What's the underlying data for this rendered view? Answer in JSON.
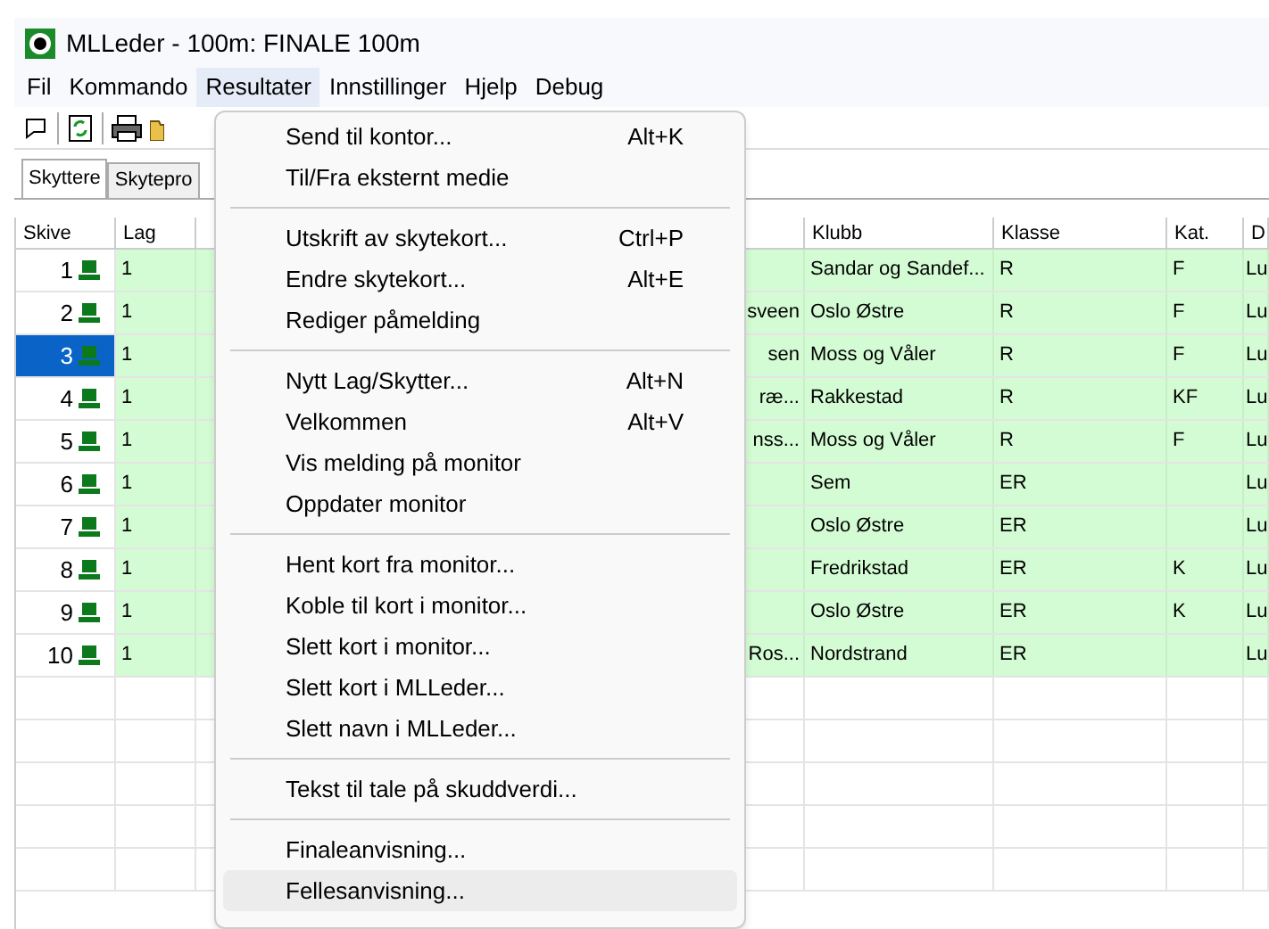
{
  "window": {
    "title": "MLLeder - 100m: FINALE 100m"
  },
  "menubar": [
    {
      "label": "Fil",
      "selected": false
    },
    {
      "label": "Kommando",
      "selected": false
    },
    {
      "label": "Resultater",
      "selected": true
    },
    {
      "label": "Innstillinger",
      "selected": false
    },
    {
      "label": "Hjelp",
      "selected": false
    },
    {
      "label": "Debug",
      "selected": false
    }
  ],
  "tabs": [
    {
      "label": "Skyttere",
      "selected": true
    },
    {
      "label": "Skytepro",
      "selected": false
    }
  ],
  "table": {
    "columns": [
      "Skive",
      "Lag",
      "",
      "",
      "Klubb",
      "Klasse",
      "Kat.",
      "D"
    ],
    "rows": [
      {
        "skive": "1",
        "lag": "1",
        "name": "",
        "klubb": "Sandar og Sandef...",
        "klasse": "R",
        "kat": "F",
        "d": "Lu",
        "selected": false
      },
      {
        "skive": "2",
        "lag": "1",
        "name": "sveen",
        "klubb": "Oslo Østre",
        "klasse": "R",
        "kat": "F",
        "d": "Lu",
        "selected": false
      },
      {
        "skive": "3",
        "lag": "1",
        "name": "sen",
        "klubb": "Moss og Våler",
        "klasse": "R",
        "kat": "F",
        "d": "Lu",
        "selected": true
      },
      {
        "skive": "4",
        "lag": "1",
        "name": "ræ...",
        "klubb": "Rakkestad",
        "klasse": "R",
        "kat": "KF",
        "d": "Lu",
        "selected": false
      },
      {
        "skive": "5",
        "lag": "1",
        "name": "nss...",
        "klubb": "Moss og Våler",
        "klasse": "R",
        "kat": "F",
        "d": "Lu",
        "selected": false
      },
      {
        "skive": "6",
        "lag": "1",
        "name": "",
        "klubb": "Sem",
        "klasse": "ER",
        "kat": "",
        "d": "Lu",
        "selected": false
      },
      {
        "skive": "7",
        "lag": "1",
        "name": "",
        "klubb": "Oslo Østre",
        "klasse": "ER",
        "kat": "",
        "d": "Lu",
        "selected": false
      },
      {
        "skive": "8",
        "lag": "1",
        "name": "",
        "klubb": "Fredrikstad",
        "klasse": "ER",
        "kat": "K",
        "d": "Lu",
        "selected": false
      },
      {
        "skive": "9",
        "lag": "1",
        "name": "",
        "klubb": "Oslo Østre",
        "klasse": "ER",
        "kat": "K",
        "d": "Lu",
        "selected": false
      },
      {
        "skive": "10",
        "lag": "1",
        "name": "Ros...",
        "klubb": "Nordstrand",
        "klasse": "ER",
        "kat": "",
        "d": "Lu",
        "selected": false
      }
    ]
  },
  "menu": {
    "items": [
      {
        "kind": "item",
        "label": "Send til kontor...",
        "shortcut": "Alt+K",
        "selected": false
      },
      {
        "kind": "item",
        "label": "Til/Fra eksternt medie",
        "selected": false
      },
      {
        "kind": "separator"
      },
      {
        "kind": "item",
        "label": "Utskrift av skytekort...",
        "shortcut": "Ctrl+P",
        "selected": false
      },
      {
        "kind": "item",
        "label": "Endre skytekort...",
        "shortcut": "Alt+E",
        "selected": false
      },
      {
        "kind": "item",
        "label": "Rediger påmelding",
        "selected": false
      },
      {
        "kind": "separator"
      },
      {
        "kind": "item",
        "label": "Nytt Lag/Skytter...",
        "shortcut": "Alt+N",
        "selected": false
      },
      {
        "kind": "item",
        "label": "Velkommen",
        "shortcut": "Alt+V",
        "selected": false
      },
      {
        "kind": "item",
        "label": "Vis melding på monitor",
        "selected": false
      },
      {
        "kind": "item",
        "label": "Oppdater monitor",
        "selected": false
      },
      {
        "kind": "separator"
      },
      {
        "kind": "item",
        "label": "Hent kort fra monitor...",
        "selected": false
      },
      {
        "kind": "item",
        "label": "Koble til kort i monitor...",
        "selected": false
      },
      {
        "kind": "item",
        "label": "Slett kort i monitor...",
        "selected": false
      },
      {
        "kind": "item",
        "label": "Slett kort i MLLeder...",
        "selected": false
      },
      {
        "kind": "item",
        "label": "Slett navn i MLLeder...",
        "selected": false
      },
      {
        "kind": "separator"
      },
      {
        "kind": "item",
        "label": "Tekst til tale på skuddverdi...",
        "selected": false
      },
      {
        "kind": "separator"
      },
      {
        "kind": "item",
        "label": "Finaleanvisning...",
        "selected": false
      },
      {
        "kind": "item",
        "label": "Fellesanvisning...",
        "selected": true
      }
    ]
  }
}
